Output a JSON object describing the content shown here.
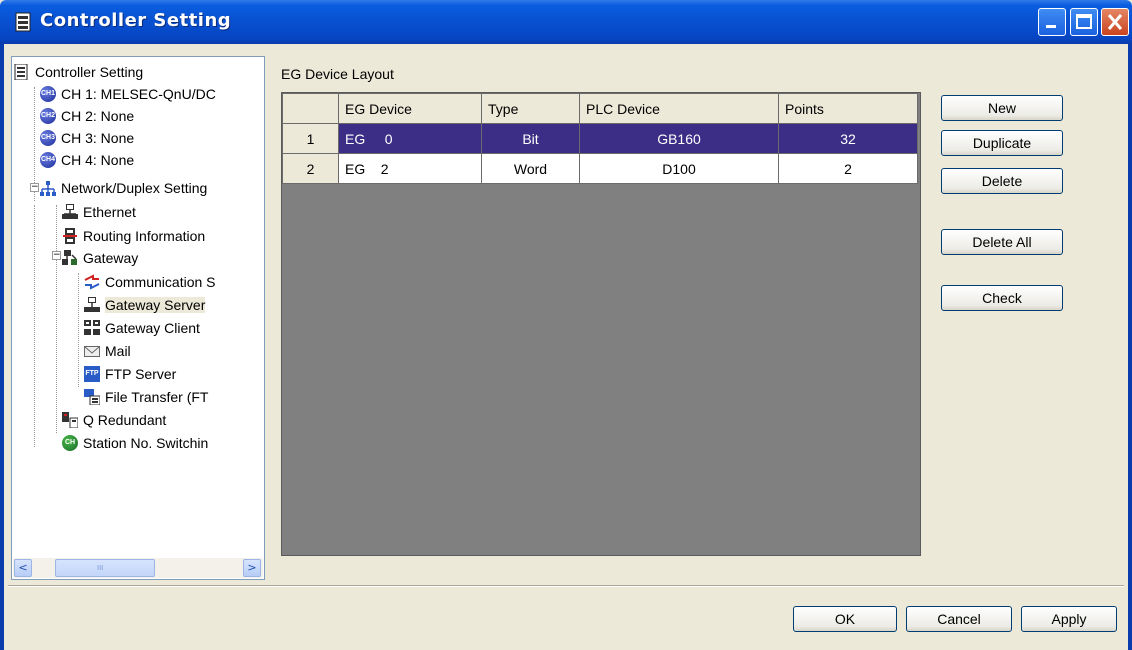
{
  "window": {
    "title": "Controller Setting",
    "colors": {
      "titlebar": "#0850d0",
      "selection": "#3c2e86",
      "grid_background": "#808080"
    }
  },
  "tree": {
    "items": [
      {
        "label": "Controller Setting",
        "icon": "controller-icon"
      },
      {
        "label": "CH 1: MELSEC-QnU/DC",
        "icon": "ch1-icon"
      },
      {
        "label": "CH 2: None",
        "icon": "ch2-icon"
      },
      {
        "label": "CH 3: None",
        "icon": "ch3-icon"
      },
      {
        "label": "CH 4: None",
        "icon": "ch4-icon"
      },
      {
        "label": "Network/Duplex Setting",
        "icon": "network-icon"
      },
      {
        "label": "Ethernet",
        "icon": "ethernet-icon"
      },
      {
        "label": "Routing Information",
        "icon": "routing-icon"
      },
      {
        "label": "Gateway",
        "icon": "gateway-icon"
      },
      {
        "label": "Communication S",
        "icon": "communication-icon"
      },
      {
        "label": "Gateway Server",
        "icon": "gateway-server-icon"
      },
      {
        "label": "Gateway Client",
        "icon": "gateway-client-icon"
      },
      {
        "label": "Mail",
        "icon": "mail-icon"
      },
      {
        "label": "FTP Server",
        "icon": "ftp-server-icon"
      },
      {
        "label": "File Transfer (FT",
        "icon": "file-transfer-icon"
      },
      {
        "label": "Q Redundant",
        "icon": "q-redundant-icon"
      },
      {
        "label": "Station No. Switchin",
        "icon": "station-switch-icon"
      }
    ],
    "icon_texts": {
      "ch1": "CH1",
      "ch2": "CH2",
      "ch3": "CH3",
      "ch4": "CH4",
      "ftp": "FTP",
      "ch": "CH"
    },
    "scroll": {
      "left": "<",
      "right": ">",
      "grip": "III"
    }
  },
  "layout_label": "EG Device Layout",
  "table": {
    "headers": [
      "",
      "EG Device",
      "Type",
      "PLC Device",
      "Points"
    ],
    "rows": [
      {
        "no": "1",
        "eg_prefix": "EG",
        "eg_num": "0",
        "type": "Bit",
        "plc": "GB160",
        "points": "32"
      },
      {
        "no": "2",
        "eg_prefix": "EG",
        "eg_num": "2",
        "type": "Word",
        "plc": "D100",
        "points": "2"
      }
    ]
  },
  "buttons": {
    "new": "New",
    "duplicate": "Duplicate",
    "delete": "Delete",
    "delete_all": "Delete All",
    "check": "Check",
    "ok": "OK",
    "cancel": "Cancel",
    "apply": "Apply"
  }
}
